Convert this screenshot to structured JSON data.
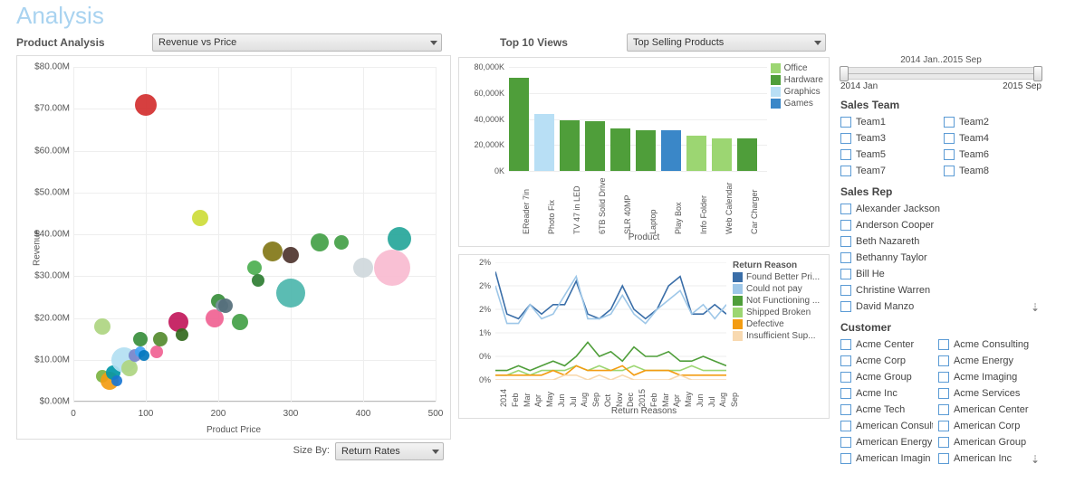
{
  "title": "Analysis",
  "scatter": {
    "section_label": "Product Analysis",
    "dropdown_value": "Revenue vs Price",
    "y_label": "Revenue",
    "x_label": "Product Price",
    "size_by_label": "Size By:",
    "size_by_value": "Return Rates",
    "y_ticks": [
      "$0.00M",
      "$10.00M",
      "$20.00M",
      "$30.00M",
      "$40.00M",
      "$50.00M",
      "$60.00M",
      "$70.00M",
      "$80.00M"
    ],
    "x_ticks": [
      "0",
      "100",
      "200",
      "300",
      "400",
      "500"
    ]
  },
  "top10": {
    "section_label": "Top 10 Views",
    "dropdown_value": "Top Selling Products",
    "y_ticks": [
      "0K",
      "20,000K",
      "40,000K",
      "60,000K",
      "80,000K"
    ],
    "x_title": "Product",
    "legend": {
      "office": "Office",
      "hardware": "Hardware",
      "graphics": "Graphics",
      "games": "Games"
    },
    "bars": [
      {
        "label": "EReader 7in",
        "value": 72000,
        "cat": "hardware"
      },
      {
        "label": "Photo Fix",
        "value": 44000,
        "cat": "graphics"
      },
      {
        "label": "TV 47 in LED",
        "value": 39000,
        "cat": "hardware"
      },
      {
        "label": "6TB Solid Drive",
        "value": 38000,
        "cat": "hardware"
      },
      {
        "label": "SLR 40MP",
        "value": 33000,
        "cat": "hardware"
      },
      {
        "label": "Laptop",
        "value": 31000,
        "cat": "hardware"
      },
      {
        "label": "Play Box",
        "value": 31000,
        "cat": "games"
      },
      {
        "label": "Info Folder",
        "value": 27000,
        "cat": "office"
      },
      {
        "label": "Web Calendar",
        "value": 25000,
        "cat": "office"
      },
      {
        "label": "Car Charger",
        "value": 25000,
        "cat": "hardware"
      }
    ]
  },
  "returns": {
    "title": "Return Reasons",
    "legend_title": "Return Reason",
    "y_ticks": [
      "0%",
      "0%",
      "1%",
      "2%",
      "2%",
      "2%"
    ],
    "x_labels": [
      "2014",
      "Feb",
      "Mar",
      "Apr",
      "May",
      "Jun",
      "Jul",
      "Aug",
      "Sep",
      "Oct",
      "Nov",
      "Dec",
      "2015",
      "Feb",
      "Mar",
      "Apr",
      "May",
      "Jun",
      "Jul",
      "Aug",
      "Sep"
    ],
    "legend": {
      "found": "Found Better Pri...",
      "couldnot": "Could not pay",
      "notfunc": "Not Functioning ...",
      "shipped": "Shipped Broken",
      "defective": "Defective",
      "insuff": "Insufficient Sup..."
    }
  },
  "slider": {
    "label": "2014 Jan..2015 Sep",
    "start": "2014 Jan",
    "end": "2015 Sep"
  },
  "filters": {
    "team_heading": "Sales Team",
    "teams": [
      "Team1",
      "Team2",
      "Team3",
      "Team4",
      "Team5",
      "Team6",
      "Team7",
      "Team8"
    ],
    "rep_heading": "Sales Rep",
    "reps": [
      "Alexander Jackson",
      "Anderson Cooper",
      "Beth Nazareth",
      "Bethanny Taylor",
      "Bill He",
      "Christine Warren",
      "David Manzo"
    ],
    "cust_heading": "Customer",
    "customers": [
      "Acme Center",
      "Acme Consulting",
      "Acme Corp",
      "Acme Energy",
      "Acme Group",
      "Acme Imaging",
      "Acme Inc",
      "Acme Services",
      "Acme Tech",
      "American Center",
      "American Consult",
      "American Corp",
      "American Energy",
      "American Group",
      "American Imagin",
      "American Inc"
    ]
  },
  "chart_data": [
    {
      "type": "scatter",
      "title": "Revenue vs Price",
      "xlabel": "Product Price",
      "ylabel": "Revenue",
      "xlim": [
        0,
        500
      ],
      "ylim": [
        0,
        80000000
      ],
      "size_by": "Return Rates",
      "points": [
        {
          "x": 40,
          "y": 6,
          "size": 7,
          "color": "#7cb342"
        },
        {
          "x": 50,
          "y": 5,
          "size": 10,
          "color": "#f39c12"
        },
        {
          "x": 55,
          "y": 7,
          "size": 8,
          "color": "#0097a7"
        },
        {
          "x": 60,
          "y": 5,
          "size": 6,
          "color": "#1976d2"
        },
        {
          "x": 70,
          "y": 10,
          "size": 14,
          "color": "#b3e0f2"
        },
        {
          "x": 78,
          "y": 8,
          "size": 9,
          "color": "#aed581"
        },
        {
          "x": 85,
          "y": 11,
          "size": 7,
          "color": "#7986cb"
        },
        {
          "x": 92,
          "y": 12,
          "size": 6,
          "color": "#42a5f5"
        },
        {
          "x": 92,
          "y": 15,
          "size": 8,
          "color": "#388e3c"
        },
        {
          "x": 98,
          "y": 11,
          "size": 6,
          "color": "#0277bd"
        },
        {
          "x": 115,
          "y": 12,
          "size": 7,
          "color": "#f06292"
        },
        {
          "x": 40,
          "y": 18,
          "size": 9,
          "color": "#aed581"
        },
        {
          "x": 100,
          "y": 71,
          "size": 12,
          "color": "#d32f2f"
        },
        {
          "x": 120,
          "y": 15,
          "size": 8,
          "color": "#558b2f"
        },
        {
          "x": 145,
          "y": 19,
          "size": 11,
          "color": "#c2185b"
        },
        {
          "x": 150,
          "y": 16,
          "size": 7,
          "color": "#33691e"
        },
        {
          "x": 175,
          "y": 44,
          "size": 9,
          "color": "#cddc39"
        },
        {
          "x": 195,
          "y": 20,
          "size": 10,
          "color": "#f06292"
        },
        {
          "x": 200,
          "y": 24,
          "size": 8,
          "color": "#388e3c"
        },
        {
          "x": 205,
          "y": 23,
          "size": 7,
          "color": "#78909c"
        },
        {
          "x": 210,
          "y": 23,
          "size": 8,
          "color": "#546e7a"
        },
        {
          "x": 230,
          "y": 19,
          "size": 9,
          "color": "#43a047"
        },
        {
          "x": 250,
          "y": 32,
          "size": 8,
          "color": "#4caf50"
        },
        {
          "x": 255,
          "y": 29,
          "size": 7,
          "color": "#2e7d32"
        },
        {
          "x": 275,
          "y": 36,
          "size": 11,
          "color": "#827717"
        },
        {
          "x": 300,
          "y": 26,
          "size": 16,
          "color": "#4db6ac"
        },
        {
          "x": 300,
          "y": 35,
          "size": 9,
          "color": "#4e342e"
        },
        {
          "x": 340,
          "y": 38,
          "size": 10,
          "color": "#43a047"
        },
        {
          "x": 370,
          "y": 38,
          "size": 8,
          "color": "#43a047"
        },
        {
          "x": 400,
          "y": 32,
          "size": 11,
          "color": "#cfd8dc"
        },
        {
          "x": 440,
          "y": 32,
          "size": 20,
          "color": "#f8bbd0"
        },
        {
          "x": 450,
          "y": 39,
          "size": 13,
          "color": "#26a69a"
        }
      ]
    },
    {
      "type": "bar",
      "title": "Top Selling Products",
      "xlabel": "Product",
      "ylabel": "",
      "ylim": [
        0,
        80000
      ],
      "categories": [
        "EReader 7in",
        "Photo Fix",
        "TV 47 in LED",
        "6TB Solid Drive",
        "SLR 40MP",
        "Laptop",
        "Play Box",
        "Info Folder",
        "Web Calendar",
        "Car Charger"
      ],
      "values": [
        72000,
        44000,
        39000,
        38000,
        33000,
        31000,
        31000,
        27000,
        25000,
        25000
      ],
      "colors": [
        "#4f9e3a",
        "#b8dff5",
        "#4f9e3a",
        "#4f9e3a",
        "#4f9e3a",
        "#4f9e3a",
        "#3a87c8",
        "#9cd672",
        "#9cd672",
        "#4f9e3a"
      ],
      "legend": {
        "Office": "#9cd672",
        "Hardware": "#4f9e3a",
        "Graphics": "#b8dff5",
        "Games": "#3a87c8"
      }
    },
    {
      "type": "line",
      "title": "Return Reasons",
      "ylabel": "",
      "ylim": [
        0,
        2.5
      ],
      "x": [
        "2014-01",
        "2014-02",
        "2014-03",
        "2014-04",
        "2014-05",
        "2014-06",
        "2014-07",
        "2014-08",
        "2014-09",
        "2014-10",
        "2014-11",
        "2014-12",
        "2015-01",
        "2015-02",
        "2015-03",
        "2015-04",
        "2015-05",
        "2015-06",
        "2015-07",
        "2015-08",
        "2015-09"
      ],
      "series": [
        {
          "name": "Found Better Price",
          "color": "#3a6ea8",
          "values": [
            2.3,
            1.4,
            1.3,
            1.6,
            1.4,
            1.6,
            1.6,
            2.1,
            1.4,
            1.3,
            1.5,
            2.0,
            1.5,
            1.3,
            1.5,
            2.0,
            2.2,
            1.4,
            1.4,
            1.6,
            1.4
          ]
        },
        {
          "name": "Could not pay",
          "color": "#9ec7e8",
          "values": [
            2.0,
            1.2,
            1.2,
            1.6,
            1.3,
            1.4,
            1.8,
            2.2,
            1.3,
            1.3,
            1.4,
            1.8,
            1.4,
            1.2,
            1.5,
            1.7,
            1.9,
            1.4,
            1.6,
            1.3,
            1.6
          ]
        },
        {
          "name": "Not Functioning",
          "color": "#4f9e3a",
          "values": [
            0.2,
            0.2,
            0.3,
            0.2,
            0.3,
            0.4,
            0.3,
            0.5,
            0.8,
            0.5,
            0.6,
            0.4,
            0.7,
            0.5,
            0.5,
            0.6,
            0.4,
            0.4,
            0.5,
            0.4,
            0.3
          ]
        },
        {
          "name": "Shipped Broken",
          "color": "#9cd672",
          "values": [
            0.1,
            0.1,
            0.2,
            0.1,
            0.2,
            0.2,
            0.2,
            0.3,
            0.2,
            0.3,
            0.2,
            0.2,
            0.3,
            0.2,
            0.2,
            0.2,
            0.2,
            0.3,
            0.2,
            0.2,
            0.2
          ]
        },
        {
          "name": "Defective",
          "color": "#f39c12",
          "values": [
            0.1,
            0.1,
            0.1,
            0.1,
            0.1,
            0.2,
            0.1,
            0.3,
            0.2,
            0.2,
            0.2,
            0.3,
            0.1,
            0.2,
            0.2,
            0.2,
            0.1,
            0.1,
            0.1,
            0.1,
            0.1
          ]
        },
        {
          "name": "Insufficient Supply",
          "color": "#f8d9b0",
          "values": [
            0.0,
            0.0,
            0.0,
            0.0,
            0.0,
            0.0,
            0.1,
            0.1,
            0.0,
            0.1,
            0.0,
            0.1,
            0.0,
            0.0,
            0.0,
            0.0,
            0.1,
            0.0,
            0.0,
            0.0,
            0.0
          ]
        }
      ]
    }
  ]
}
